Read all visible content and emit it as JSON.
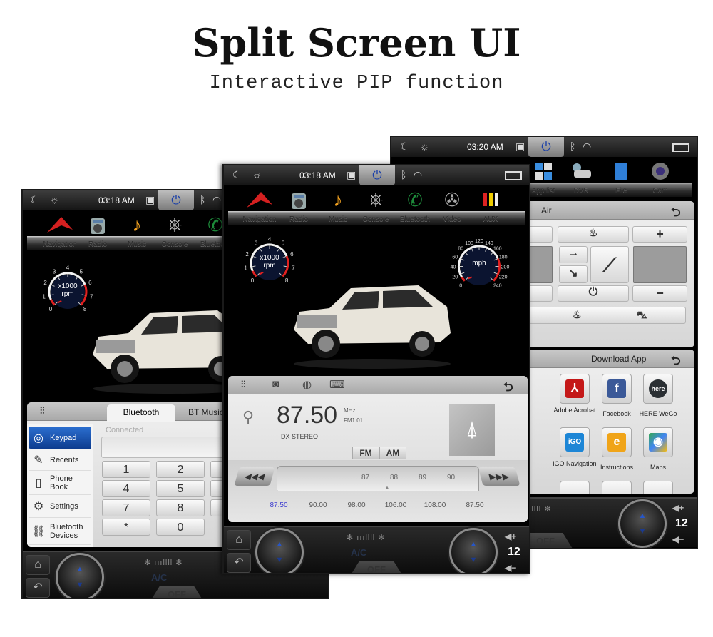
{
  "header": {
    "title": "Split Screen UI",
    "subtitle": "Interactive PIP function"
  },
  "status_icons": {
    "night": "moon-icon",
    "brightness": "sun-icon",
    "usb": "usb-icon",
    "power": "power-icon",
    "bluetooth": "bluetooth-icon",
    "wifi": "wifi-icon",
    "window": "split-window-icon"
  },
  "gauges": {
    "rpm": {
      "unit_line1": "x1000",
      "unit_line2": "rpm",
      "ticks": [
        "0",
        "1",
        "2",
        "3",
        "4",
        "5",
        "6",
        "7",
        "8"
      ],
      "redline_from": "6"
    },
    "speed": {
      "unit": "mph",
      "ticks": [
        "0",
        "20",
        "40",
        "60",
        "80",
        "100",
        "120",
        "140",
        "160",
        "180",
        "200",
        "220",
        "240"
      ],
      "redline_from": "180"
    }
  },
  "left": {
    "time": "03:18 AM",
    "nav": [
      "Navigation",
      "Radio",
      "Music",
      "Console",
      "Bluetooth"
    ],
    "bluetooth": {
      "tabs": [
        "Bluetooth",
        "BT Music"
      ],
      "status": "Connected",
      "menu": [
        "Keypad",
        "Recents",
        "Phone Book",
        "Settings",
        "Bluetooth Devices"
      ],
      "keys": [
        "1",
        "2",
        "4",
        "5",
        "7",
        "8",
        "*",
        "0"
      ]
    }
  },
  "middle": {
    "time": "03:18 AM",
    "nav": [
      "Navigation",
      "Radio",
      "Music",
      "Console",
      "Bluetooth",
      "Video",
      "AUX"
    ],
    "radio": {
      "frequency": "87.50",
      "unit": "MHz",
      "band_info": "FM1  01",
      "mode": "DX  STEREO",
      "bands": [
        "FM",
        "AM"
      ],
      "scale": [
        "87",
        "88",
        "89",
        "90"
      ],
      "presets": [
        "87.50",
        "90.00",
        "98.00",
        "106.00",
        "108.00",
        "87.50"
      ],
      "active_preset_color": "#3a3ad0"
    }
  },
  "right": {
    "time": "03:20 AM",
    "nav": [
      "App list",
      "DVR",
      "File",
      "Cam"
    ],
    "air": {
      "title": "Air",
      "plus": "+",
      "minus": "−"
    },
    "apps": {
      "title": "Download App",
      "items": [
        "Adobe Acrobat",
        "Facebook",
        "HERE WeGo",
        "iGO Navigation",
        "Instructions",
        "Maps"
      ]
    }
  },
  "climate": {
    "ac": "A/C",
    "off": "OFF",
    "temp": "12"
  }
}
